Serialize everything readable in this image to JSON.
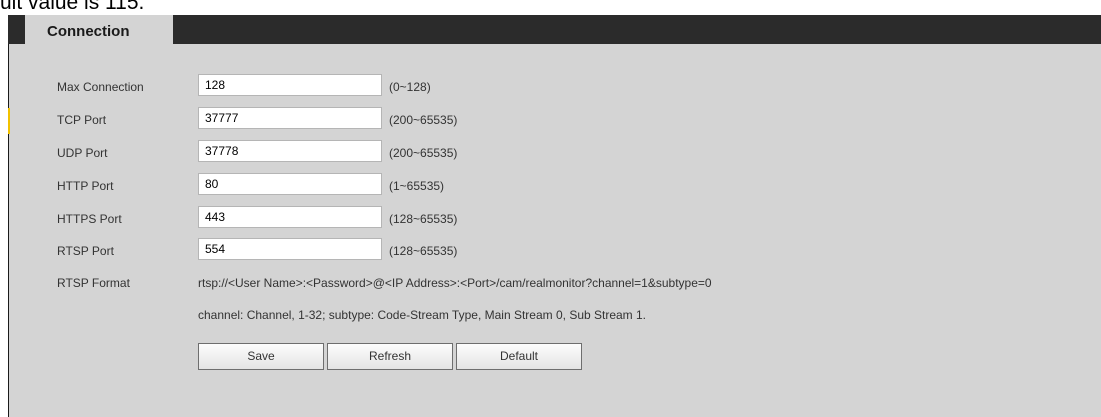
{
  "caption": "ult value is 115.",
  "tab": {
    "label": "Connection"
  },
  "fields": [
    {
      "label": "Max Connection",
      "value": "128",
      "range": "(0~128)"
    },
    {
      "label": "TCP Port",
      "value": "37777",
      "range": "(200~65535)"
    },
    {
      "label": "UDP Port",
      "value": "37778",
      "range": "(200~65535)"
    },
    {
      "label": "HTTP Port",
      "value": "80",
      "range": "(1~65535)"
    },
    {
      "label": "HTTPS Port",
      "value": "443",
      "range": "(128~65535)"
    },
    {
      "label": "RTSP Port",
      "value": "554",
      "range": "(128~65535)"
    }
  ],
  "rtsp": {
    "label": "RTSP Format",
    "format": "rtsp://<User Name>:<Password>@<IP Address>:<Port>/cam/realmonitor?channel=1&subtype=0",
    "note": "channel: Channel, 1-32; subtype: Code-Stream Type, Main Stream 0, Sub Stream 1."
  },
  "buttons": {
    "save": "Save",
    "refresh": "Refresh",
    "default": "Default"
  },
  "colors": {
    "panel": "#d4d4d4",
    "tabbar": "#2b2b2b",
    "marker": "#f2c200"
  }
}
